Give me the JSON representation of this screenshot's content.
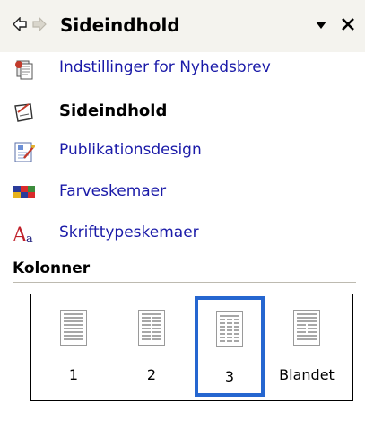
{
  "header": {
    "title": "Sideindhold",
    "back_icon": "back-arrow-icon",
    "forward_icon": "forward-arrow-icon",
    "menu_icon": "dropdown-triangle-icon",
    "close_icon": "close-icon"
  },
  "nav": {
    "items": [
      {
        "label": "Indstillinger for Nyhedsbrev",
        "icon": "newsletter-settings-icon"
      },
      {
        "label": "Sideindhold",
        "icon": "page-content-icon",
        "current": true
      },
      {
        "label": "Publikationsdesign",
        "icon": "publication-design-icon"
      },
      {
        "label": "Farveskemaer",
        "icon": "color-schemes-icon"
      },
      {
        "label": "Skrifttypeskemaer",
        "icon": "font-schemes-icon"
      }
    ]
  },
  "columns": {
    "title": "Kolonner",
    "options": [
      {
        "label": "1",
        "icon": "one-column-page-icon"
      },
      {
        "label": "2",
        "icon": "two-column-page-icon"
      },
      {
        "label": "3",
        "icon": "three-column-page-icon",
        "selected": true
      },
      {
        "label": "Blandet",
        "icon": "mixed-column-page-icon"
      }
    ]
  },
  "colors": {
    "link": "#1a1aa8",
    "header_bg": "#f4f3ee",
    "selection_border": "#2566d0"
  }
}
